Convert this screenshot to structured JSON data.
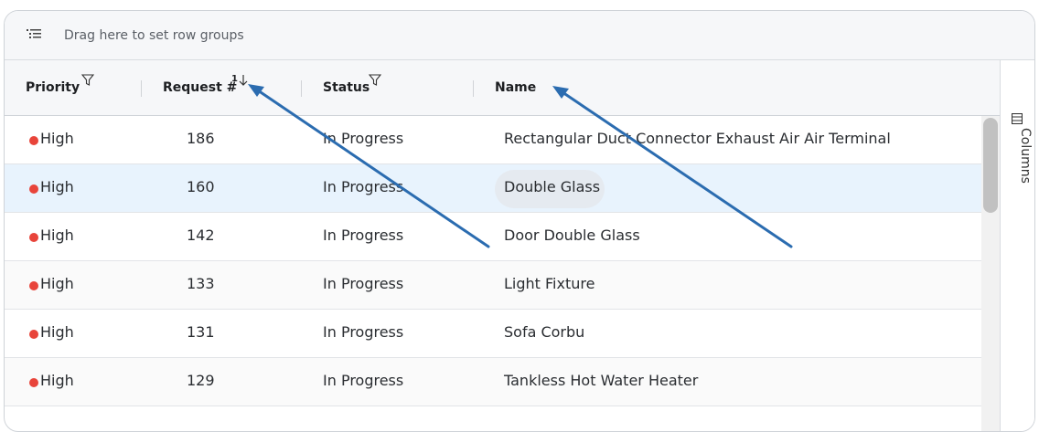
{
  "group_bar": {
    "placeholder": "Drag here to set row groups",
    "icon": "row-groups-icon"
  },
  "columns": [
    {
      "label": "Priority",
      "filter": true
    },
    {
      "label": "Request #",
      "sort_index": "1",
      "sort_direction": "descending"
    },
    {
      "label": "Status",
      "filter": true
    },
    {
      "label": "Name"
    }
  ],
  "side_panel": {
    "label": "Columns",
    "icon": "columns-icon"
  },
  "rows": [
    {
      "priority": "High",
      "request": "186",
      "status": "In Progress",
      "name": "Rectangular Duct Connector Exhaust Air Air Terminal"
    },
    {
      "priority": "High",
      "request": "160",
      "status": "In Progress",
      "name": "Double Glass",
      "selected": true
    },
    {
      "priority": "High",
      "request": "142",
      "status": "In Progress",
      "name": "Door Double Glass"
    },
    {
      "priority": "High",
      "request": "133",
      "status": "In Progress",
      "name": "Light Fixture"
    },
    {
      "priority": "High",
      "request": "131",
      "status": "In Progress",
      "name": "Sofa Corbu"
    },
    {
      "priority": "High",
      "request": "129",
      "status": "In Progress",
      "name": "Tankless Hot Water Heater"
    }
  ],
  "colors": {
    "priority_high": "#e8443a",
    "selected_row": "#e8f3fd",
    "annotation_arrow": "#2b6cb0"
  }
}
